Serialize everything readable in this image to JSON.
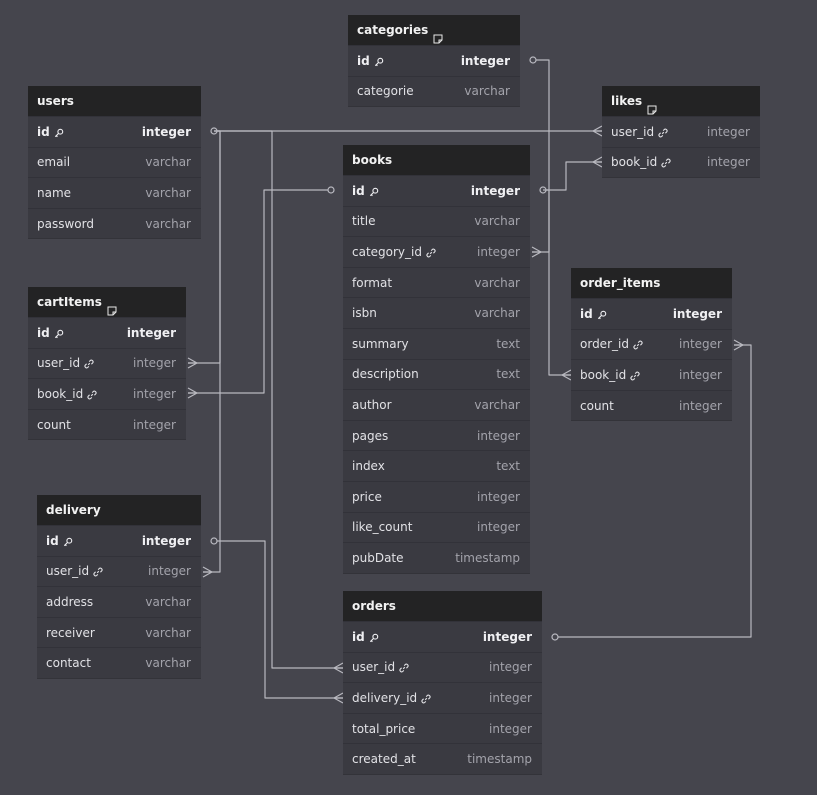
{
  "tables": [
    {
      "id": "users",
      "name": "users",
      "note": false,
      "fields": [
        {
          "name": "id",
          "type": "integer",
          "pk": true,
          "fk": false
        },
        {
          "name": "email",
          "type": "varchar",
          "pk": false,
          "fk": false
        },
        {
          "name": "name",
          "type": "varchar",
          "pk": false,
          "fk": false
        },
        {
          "name": "password",
          "type": "varchar",
          "pk": false,
          "fk": false
        }
      ]
    },
    {
      "id": "categories",
      "name": "categories",
      "note": true,
      "fields": [
        {
          "name": "id",
          "type": "integer",
          "pk": true,
          "fk": false
        },
        {
          "name": "categorie",
          "type": "varchar",
          "pk": false,
          "fk": false
        }
      ]
    },
    {
      "id": "likes",
      "name": "likes",
      "note": true,
      "fields": [
        {
          "name": "user_id",
          "type": "integer",
          "pk": false,
          "fk": true
        },
        {
          "name": "book_id",
          "type": "integer",
          "pk": false,
          "fk": true
        }
      ]
    },
    {
      "id": "books",
      "name": "books",
      "note": false,
      "fields": [
        {
          "name": "id",
          "type": "integer",
          "pk": true,
          "fk": false
        },
        {
          "name": "title",
          "type": "varchar",
          "pk": false,
          "fk": false
        },
        {
          "name": "category_id",
          "type": "integer",
          "pk": false,
          "fk": true
        },
        {
          "name": "format",
          "type": "varchar",
          "pk": false,
          "fk": false
        },
        {
          "name": "isbn",
          "type": "varchar",
          "pk": false,
          "fk": false
        },
        {
          "name": "summary",
          "type": "text",
          "pk": false,
          "fk": false
        },
        {
          "name": "description",
          "type": "text",
          "pk": false,
          "fk": false
        },
        {
          "name": "author",
          "type": "varchar",
          "pk": false,
          "fk": false
        },
        {
          "name": "pages",
          "type": "integer",
          "pk": false,
          "fk": false
        },
        {
          "name": "index",
          "type": "text",
          "pk": false,
          "fk": false
        },
        {
          "name": "price",
          "type": "integer",
          "pk": false,
          "fk": false
        },
        {
          "name": "like_count",
          "type": "integer",
          "pk": false,
          "fk": false
        },
        {
          "name": "pubDate",
          "type": "timestamp",
          "pk": false,
          "fk": false
        }
      ]
    },
    {
      "id": "cartItems",
      "name": "cartItems",
      "note": true,
      "fields": [
        {
          "name": "id",
          "type": "integer",
          "pk": true,
          "fk": false
        },
        {
          "name": "user_id",
          "type": "integer",
          "pk": false,
          "fk": true
        },
        {
          "name": "book_id",
          "type": "integer",
          "pk": false,
          "fk": true
        },
        {
          "name": "count",
          "type": "integer",
          "pk": false,
          "fk": false
        }
      ]
    },
    {
      "id": "order_items",
      "name": "order_items",
      "note": false,
      "fields": [
        {
          "name": "id",
          "type": "integer",
          "pk": true,
          "fk": false
        },
        {
          "name": "order_id",
          "type": "integer",
          "pk": false,
          "fk": true
        },
        {
          "name": "book_id",
          "type": "integer",
          "pk": false,
          "fk": true
        },
        {
          "name": "count",
          "type": "integer",
          "pk": false,
          "fk": false
        }
      ]
    },
    {
      "id": "delivery",
      "name": "delivery",
      "note": false,
      "fields": [
        {
          "name": "id",
          "type": "integer",
          "pk": true,
          "fk": false
        },
        {
          "name": "user_id",
          "type": "integer",
          "pk": false,
          "fk": true
        },
        {
          "name": "address",
          "type": "varchar",
          "pk": false,
          "fk": false
        },
        {
          "name": "receiver",
          "type": "varchar",
          "pk": false,
          "fk": false
        },
        {
          "name": "contact",
          "type": "varchar",
          "pk": false,
          "fk": false
        }
      ]
    },
    {
      "id": "orders",
      "name": "orders",
      "note": false,
      "fields": [
        {
          "name": "id",
          "type": "integer",
          "pk": true,
          "fk": false
        },
        {
          "name": "user_id",
          "type": "integer",
          "pk": false,
          "fk": true
        },
        {
          "name": "delivery_id",
          "type": "integer",
          "pk": false,
          "fk": true
        },
        {
          "name": "total_price",
          "type": "integer",
          "pk": false,
          "fk": false
        },
        {
          "name": "created_at",
          "type": "timestamp",
          "pk": false,
          "fk": false
        }
      ]
    }
  ],
  "relations": [
    {
      "from": "users.id",
      "to": "likes.user_id",
      "cardinality": "one-to-many"
    },
    {
      "from": "users.id",
      "to": "cartItems.user_id",
      "cardinality": "one-to-many"
    },
    {
      "from": "users.id",
      "to": "delivery.user_id",
      "cardinality": "one-to-many"
    },
    {
      "from": "users.id",
      "to": "orders.user_id",
      "cardinality": "one-to-many"
    },
    {
      "from": "categories.id",
      "to": "books.category_id",
      "cardinality": "one-to-many"
    },
    {
      "from": "books.id",
      "to": "likes.book_id",
      "cardinality": "one-to-many"
    },
    {
      "from": "books.id",
      "to": "cartItems.book_id",
      "cardinality": "one-to-many"
    },
    {
      "from": "books.id",
      "to": "order_items.book_id",
      "cardinality": "one-to-many"
    },
    {
      "from": "orders.id",
      "to": "order_items.order_id",
      "cardinality": "one-to-many"
    },
    {
      "from": "delivery.id",
      "to": "orders.delivery_id",
      "cardinality": "one-to-many"
    }
  ],
  "colors": {
    "canvas": "#45454d",
    "header": "#232324",
    "body": "#3a3a41",
    "line": "#b9b9c0"
  }
}
